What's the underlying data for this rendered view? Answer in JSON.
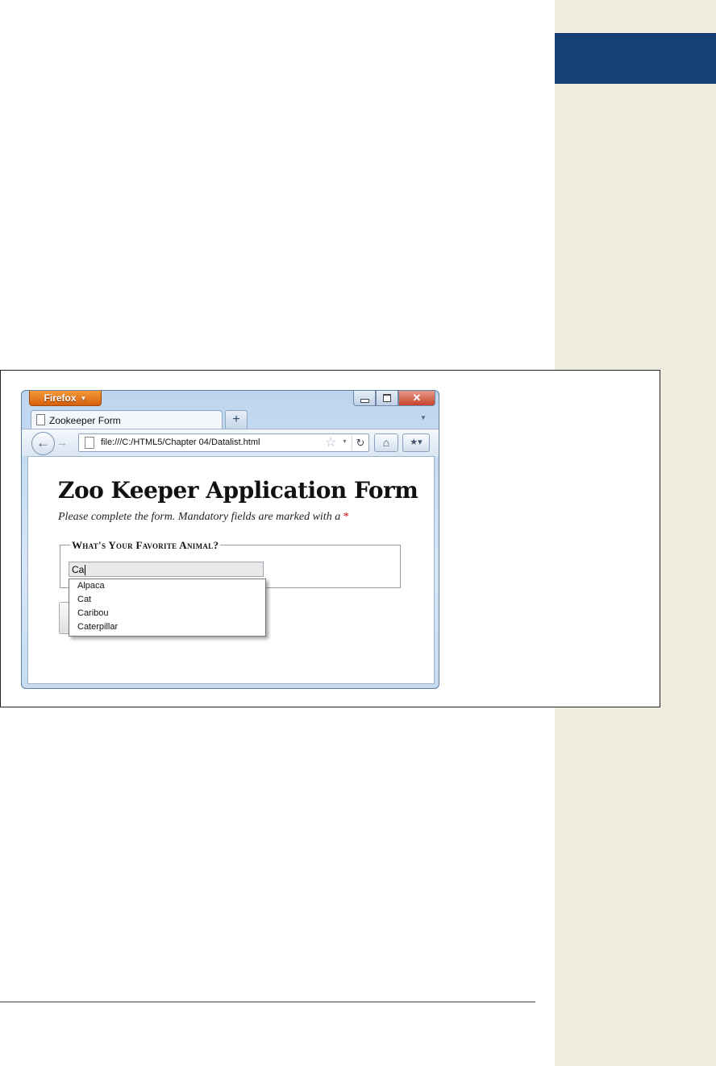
{
  "browser": {
    "app_menu_label": "Firefox",
    "tab_title": "Zookeeper Form",
    "new_tab_symbol": "+",
    "address_url": "file:///C:/HTML5/Chapter 04/Datalist.html",
    "icons": [
      "back-arrow",
      "forward-arrow",
      "page",
      "bookmark-star",
      "reload",
      "home",
      "bookmarks-menu",
      "minimize",
      "maximize",
      "close"
    ]
  },
  "page": {
    "title": "Zoo Keeper Application Form",
    "intro": "Please complete the form. Mandatory fields are marked with a",
    "required_marker": "*",
    "fieldset_legend": "What's Your Favorite Animal?",
    "animal_input_value": "Ca",
    "suggestions": [
      "Alpaca",
      "Cat",
      "Caribou",
      "Caterpillar"
    ]
  },
  "colors": {
    "sidebar_background": "#f0ebdf",
    "sidebar_tab": "#163f73",
    "firefox_button": "#e2761f",
    "required_marker": "#cc0000"
  }
}
